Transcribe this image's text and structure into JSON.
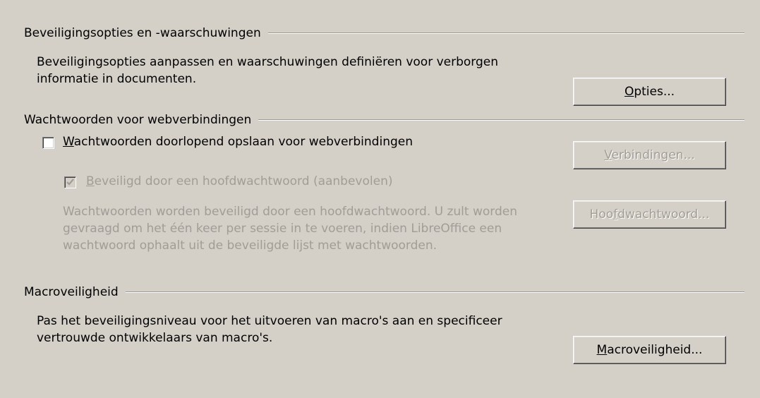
{
  "security_options": {
    "header": "Beveiligingsopties en -waarschuwingen",
    "description": "Beveiligingsopties aanpassen en waarschuwingen definiëren voor verborgen informatie in documenten.",
    "button_mnemonic": "O",
    "button_rest": "pties..."
  },
  "web_passwords": {
    "header": "Wachtwoorden voor webverbindingen",
    "persist_checkbox": {
      "mnemonic": "W",
      "label_rest": "achtwoorden doorlopend opslaan voor webverbindingen",
      "checked": false
    },
    "connections_button": {
      "mnemonic": "V",
      "rest": "erbindingen..."
    },
    "master_checkbox": {
      "mnemonic": "B",
      "label_rest": "eveiligd door een hoofdwachtwoord (aanbevolen)",
      "checked": true,
      "disabled": true
    },
    "description": "Wachtwoorden worden beveiligd door een hoofdwachtwoord. U zult worden gevraagd om het één keer per sessie in te voeren, indien LibreOffice een wachtwoord ophaalt uit de beveiligde lijst met wachtwoorden.",
    "master_button": {
      "pre": "Hoo",
      "mnemonic": "f",
      "rest": "dwachtwoord..."
    }
  },
  "macro_security": {
    "header": "Macroveiligheid",
    "description": "Pas het beveiligingsniveau voor het uitvoeren van macro's aan en specificeer vertrouwde ontwikkelaars van macro's.",
    "button_mnemonic": "M",
    "button_rest": "acroveiligheid..."
  }
}
